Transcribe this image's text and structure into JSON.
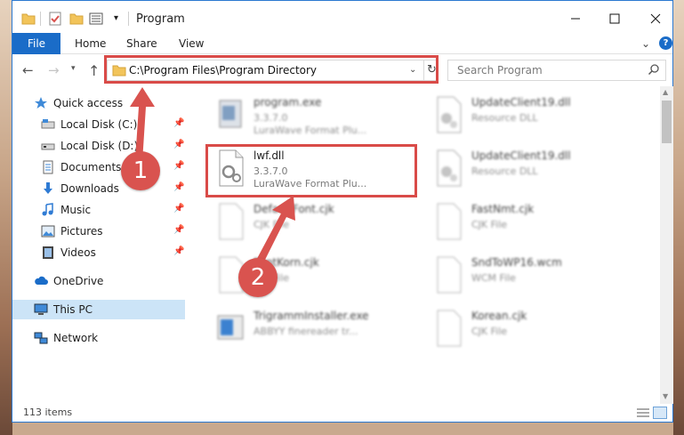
{
  "window": {
    "title": "Program"
  },
  "ribbon": {
    "file": "File",
    "home": "Home",
    "share": "Share",
    "view": "View",
    "help": "?"
  },
  "address": {
    "path": "C:\\Program Files\\Program Directory"
  },
  "search": {
    "placeholder": "Search Program"
  },
  "sidebar": {
    "items": [
      {
        "label": "Quick access",
        "icon": "star-icon"
      },
      {
        "label": "Local Disk (C:)",
        "icon": "drive-icon",
        "pinned": true
      },
      {
        "label": "Local Disk (D:)",
        "icon": "drive-icon",
        "pinned": true
      },
      {
        "label": "Documents",
        "icon": "documents-icon",
        "pinned": true
      },
      {
        "label": "Downloads",
        "icon": "download-icon",
        "pinned": true
      },
      {
        "label": "Music",
        "icon": "music-icon",
        "pinned": true
      },
      {
        "label": "Pictures",
        "icon": "pictures-icon",
        "pinned": true
      },
      {
        "label": "Videos",
        "icon": "videos-icon",
        "pinned": true
      },
      {
        "label": "OneDrive",
        "icon": "cloud-icon"
      },
      {
        "label": "This PC",
        "icon": "computer-icon",
        "selected": true
      },
      {
        "label": "Network",
        "icon": "network-icon"
      }
    ]
  },
  "files": [
    {
      "name": "program.exe",
      "meta": "3.3.7.0",
      "type": "LuraWave Format Plu...",
      "icon": "exe-icon"
    },
    {
      "name": "UpdateClient19.dll",
      "meta": "Resource DLL",
      "type": "",
      "icon": "dll-icon"
    },
    {
      "name": "lwf.dll",
      "meta": "3.3.7.0",
      "type": "LuraWave Format Plu...",
      "icon": "dll-icon"
    },
    {
      "name": "UpdateClient19.dll",
      "meta": "Resource DLL",
      "type": "",
      "icon": "dll-icon"
    },
    {
      "name": "DefaultFont.cjk",
      "meta": "CJK File",
      "type": "",
      "icon": "file-icon"
    },
    {
      "name": "FastNmt.cjk",
      "meta": "CJK File",
      "type": "",
      "icon": "file-icon"
    },
    {
      "name": "FontKorn.cjk",
      "meta": "CJK File",
      "type": "",
      "icon": "file-icon"
    },
    {
      "name": "SndToWP16.wcm",
      "meta": "WCM File",
      "type": "",
      "icon": "file-icon"
    },
    {
      "name": "TrigrammInstaller.exe",
      "meta": "ABBYY finereader tr...",
      "type": "",
      "icon": "installer-icon"
    },
    {
      "name": "Korean.cjk",
      "meta": "CJK File",
      "type": "",
      "icon": "file-icon"
    }
  ],
  "status": {
    "items": "113 items"
  },
  "annotations": {
    "step1": "1",
    "step2": "2",
    "color": "#d94b48"
  }
}
